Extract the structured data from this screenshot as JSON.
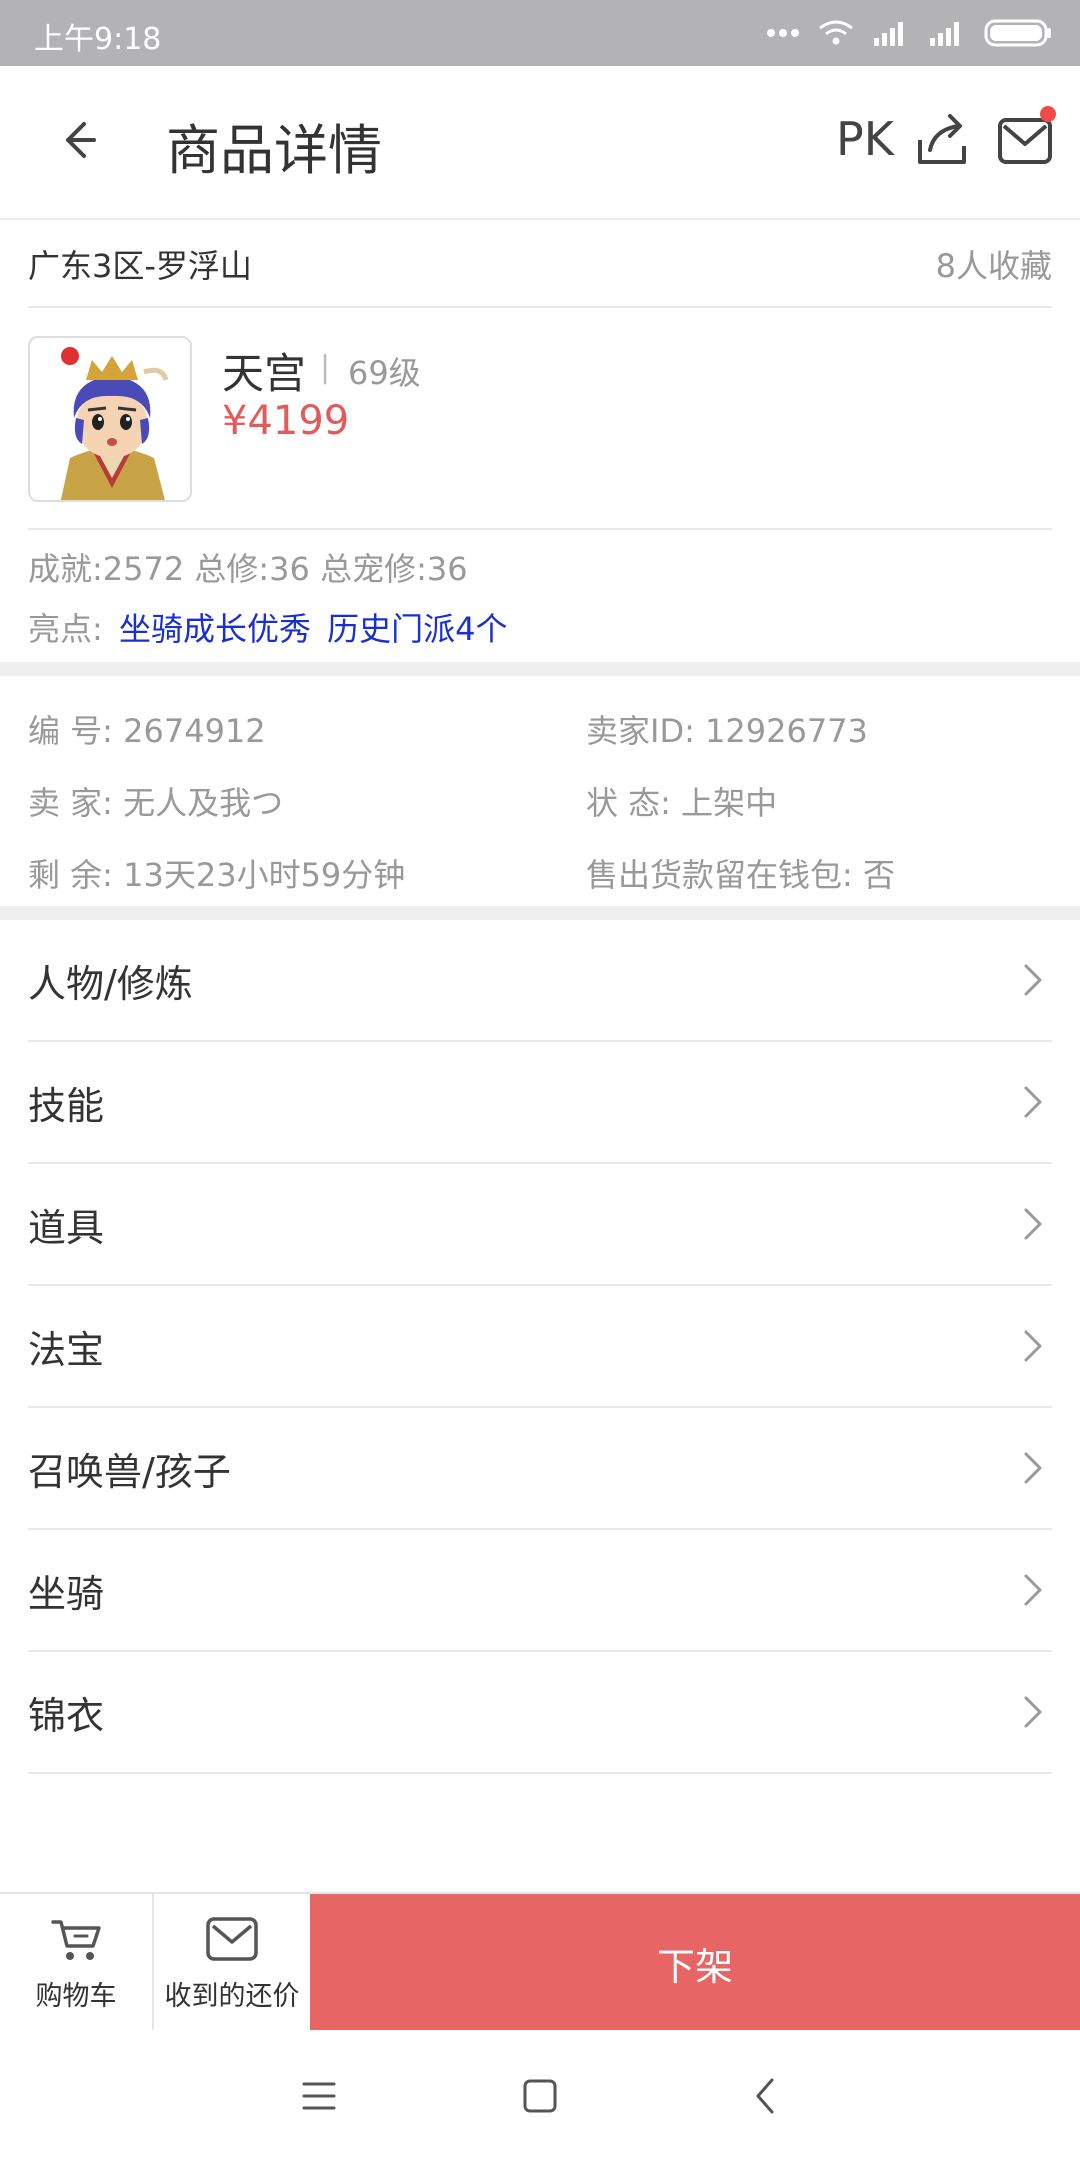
{
  "status_bar": {
    "time": "上午9:18"
  },
  "header": {
    "title": "商品详情",
    "pk_label": "PK"
  },
  "server": {
    "name": "广东3区-罗浮山",
    "favorites": "8人收藏"
  },
  "character": {
    "name": "天宫",
    "separator": "|",
    "level": "69级",
    "price": "¥4199",
    "stats": "成就:2572 总修:36 总宠修:36",
    "highlights_label": "亮点:",
    "highlights": [
      "坐骑成长优秀",
      "历史门派4个"
    ]
  },
  "info": {
    "number": "编  号: 2674912",
    "seller_id": "卖家ID: 12926773",
    "seller": "卖  家: 无人及我つ",
    "status": "状  态: 上架中",
    "remaining": "剩  余: 13天23小时59分钟",
    "wallet": "售出货款留在钱包: 否"
  },
  "menu": [
    {
      "label": "人物/修炼"
    },
    {
      "label": "技能"
    },
    {
      "label": "道具"
    },
    {
      "label": "法宝"
    },
    {
      "label": "召唤兽/孩子"
    },
    {
      "label": "坐骑"
    },
    {
      "label": "锦衣"
    }
  ],
  "actions": {
    "cart_label": "购物车",
    "offers_label": "收到的还价",
    "primary_label": "下架",
    "primary_color": "#e76565"
  },
  "colors": {
    "price": "#e25b5b",
    "highlight": "#1a2fd0",
    "statusbar": "#b3b3b6"
  }
}
